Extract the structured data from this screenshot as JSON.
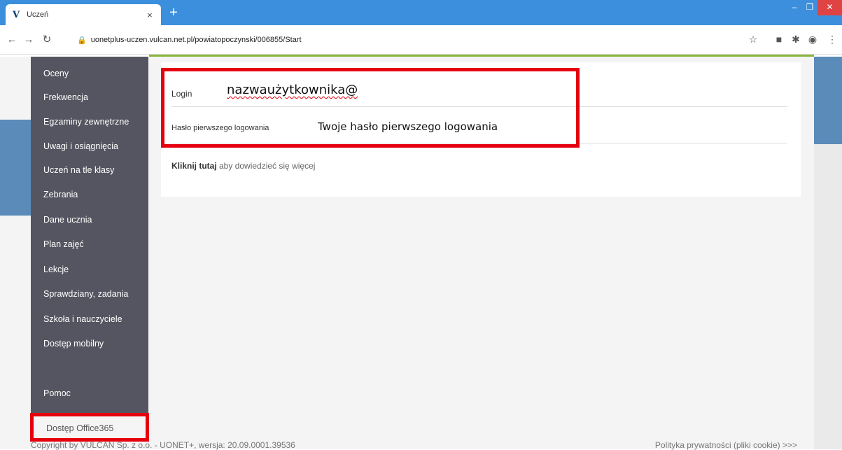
{
  "browser": {
    "tab_title": "Uczeń",
    "tab_logo": "V",
    "tab_close": "×",
    "new_tab": "+",
    "url": "uonetplus-uczen.vulcan.net.pl/powiatopoczynski/006855/Start",
    "icons": [
      "back-icon",
      "forward-icon",
      "reload-icon",
      "lock-icon",
      "star-icon",
      "extension-icon",
      "puzzle-icon",
      "account-icon",
      "menu-icon"
    ],
    "accent_color": "#3c8fdc"
  },
  "sidebar": {
    "items": [
      {
        "label": "Oceny"
      },
      {
        "label": "Frekwencja"
      },
      {
        "label": "Egzaminy zewnętrzne"
      },
      {
        "label": "Uwagi i osiągnięcia"
      },
      {
        "label": "Uczeń na tle klasy"
      },
      {
        "label": "Zebrania"
      },
      {
        "label": "Dane ucznia"
      },
      {
        "label": "Plan zajęć"
      },
      {
        "label": "Lekcje"
      },
      {
        "label": "Sprawdziany, zadania"
      },
      {
        "label": "Szkoła i nauczyciele"
      },
      {
        "label": "Dostęp mobilny"
      },
      {
        "label": "Dostęp Office365"
      },
      {
        "label": "Pomoc"
      }
    ],
    "highlighted": "Dostęp Office365"
  },
  "card": {
    "login_label": "Login",
    "login_value": "nazwaużytkownika@",
    "password_label": "Hasło pierwszego logowania",
    "password_value": "Twoje hasło pierwszego logowania",
    "info_link": "Kliknij tutaj",
    "info_text": " aby dowiedzieć się więcej"
  },
  "footer": {
    "copyright": "Copyright by VULCAN Sp. z o.o. - UONET+, wersja: 20.09.0001.39536",
    "privacy": "Polityka prywatności (pliki cookie) >>>"
  },
  "colors": {
    "highlight_red": "#e5000e",
    "sidebar_bg": "#555561",
    "green_bar": "#8ab63f"
  }
}
